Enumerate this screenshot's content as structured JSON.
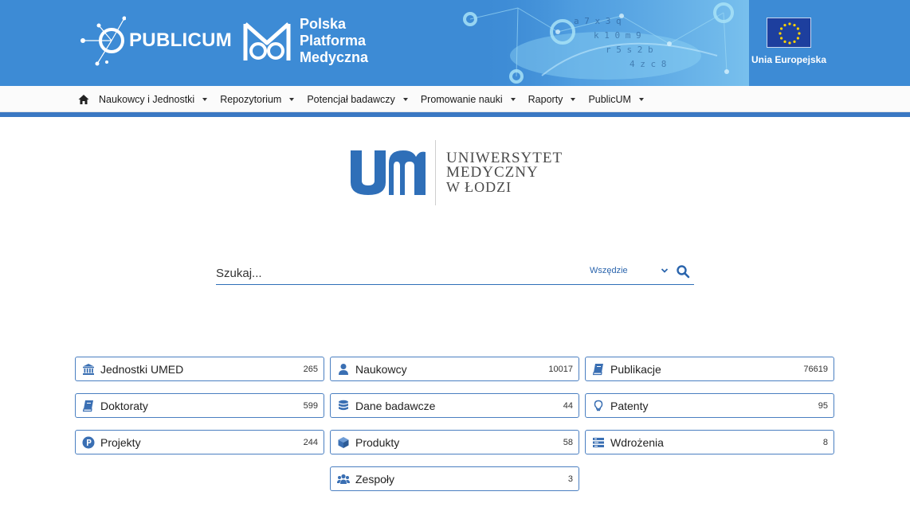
{
  "banner": {
    "publicum_logo_text": "PUBLIC",
    "publicum_logo_text_b": "UM",
    "ppm_line1": "Polska",
    "ppm_line2": "Platforma",
    "ppm_line3": "Medyczna",
    "eu_label": "Unia Europejska"
  },
  "nav": {
    "items": [
      {
        "label": "Naukowcy i Jednostki"
      },
      {
        "label": "Repozytorium"
      },
      {
        "label": "Potencjał badawczy"
      },
      {
        "label": "Promowanie nauki"
      },
      {
        "label": "Raporty"
      },
      {
        "label": "PublicUM"
      }
    ]
  },
  "university": {
    "line1": "UNIWERSYTET",
    "line2": "MEDYCZNY",
    "line3": "W ŁODZI",
    "brand_color": "#2f6fb8"
  },
  "search": {
    "placeholder": "Szukaj...",
    "scope": "Wszędzie"
  },
  "tiles": [
    {
      "label": "Jednostki UMED",
      "count": "265",
      "icon": "institution-icon"
    },
    {
      "label": "Naukowcy",
      "count": "10017",
      "icon": "user-icon"
    },
    {
      "label": "Publikacje",
      "count": "76619",
      "icon": "book-icon"
    },
    {
      "label": "Doktoraty",
      "count": "599",
      "icon": "book-icon"
    },
    {
      "label": "Dane badawcze",
      "count": "44",
      "icon": "database-icon"
    },
    {
      "label": "Patenty",
      "count": "95",
      "icon": "lightbulb-icon"
    },
    {
      "label": "Projekty",
      "count": "244",
      "icon": "project-icon"
    },
    {
      "label": "Produkty",
      "count": "58",
      "icon": "cube-icon"
    },
    {
      "label": "Wdrożenia",
      "count": "8",
      "icon": "implementation-icon"
    },
    {
      "label": "Zespoły",
      "count": "3",
      "icon": "team-icon"
    }
  ],
  "colors": {
    "banner": "#3d8bd5",
    "accent": "#2f6fb8",
    "tile_border": "#4a7fc1"
  }
}
